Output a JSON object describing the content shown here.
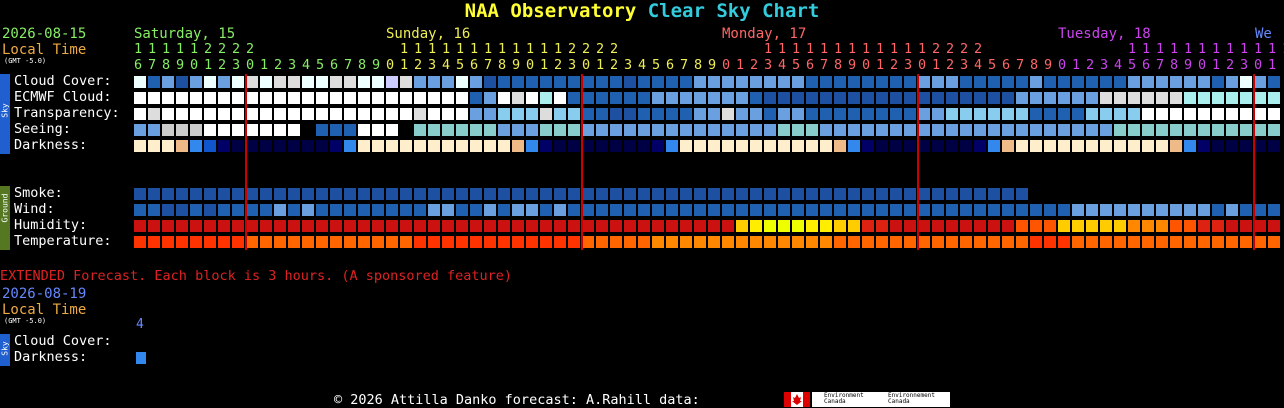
{
  "title": {
    "part1": "NAA Observatory",
    "part2": "Clear Sky Chart"
  },
  "header": {
    "date": "2026-08-15",
    "local_time": "Local Time",
    "gmt": "(GMT -5.0)"
  },
  "days": [
    {
      "label": "Saturday, 15",
      "color": "#88ee66"
    },
    {
      "label": "Sunday, 16",
      "color": "#eeee55"
    },
    {
      "label": "Monday, 17",
      "color": "#ff6666"
    },
    {
      "label": "Tuesday, 18",
      "color": "#cc44ee"
    },
    {
      "label": "We",
      "color": "#6688ff"
    }
  ],
  "hours": {
    "tens": [
      "1",
      "1",
      "1",
      "1",
      "1",
      "2",
      "2",
      "2",
      "2",
      "",
      "",
      "",
      "",
      "",
      "",
      "",
      "",
      "",
      "",
      "1",
      "1",
      "1",
      "1",
      "1",
      "1",
      "1",
      "1",
      "1",
      "1",
      "1",
      "1",
      "2",
      "2",
      "2",
      "2",
      "",
      "",
      "",
      "",
      "",
      "",
      "",
      "",
      "",
      "",
      "1",
      "1",
      "1",
      "1",
      "1",
      "1",
      "1",
      "1",
      "1",
      "1",
      "1",
      "1",
      "2",
      "2",
      "2",
      "2",
      "",
      "",
      "",
      "",
      "",
      "",
      "",
      "",
      "",
      "",
      "1",
      "1",
      "1",
      "1",
      "1",
      "1",
      "1",
      "1",
      "1",
      "1",
      "1",
      "1",
      "2",
      "2",
      "2",
      "2",
      "",
      ""
    ],
    "ones": [
      "6",
      "7",
      "8",
      "9",
      "0",
      "1",
      "2",
      "3",
      "0",
      "1",
      "2",
      "3",
      "4",
      "5",
      "6",
      "7",
      "8",
      "9",
      "0",
      "1",
      "2",
      "3",
      "4",
      "5",
      "6",
      "7",
      "8",
      "9",
      "0",
      "1",
      "2",
      "3",
      "0",
      "1",
      "2",
      "3",
      "4",
      "5",
      "6",
      "7",
      "8",
      "9",
      "0",
      "1",
      "2",
      "3",
      "4",
      "5",
      "6",
      "7",
      "8",
      "9",
      "0",
      "1",
      "2",
      "3",
      "0",
      "1",
      "2",
      "3",
      "4",
      "5",
      "6",
      "7",
      "8",
      "9",
      "0",
      "1",
      "2",
      "3",
      "4",
      "5",
      "6",
      "7",
      "8",
      "9",
      "0",
      "1",
      "2",
      "3",
      "0",
      "1"
    ]
  },
  "sky_side_label": "Sky",
  "ground_side_label": "Ground",
  "rows": [
    {
      "name": "cloud-cover",
      "label": "Cloud Cover:"
    },
    {
      "name": "ecmwf-cloud",
      "label": "ECMWF Cloud:"
    },
    {
      "name": "transparency",
      "label": "Transparency:"
    },
    {
      "name": "seeing",
      "label": "Seeing:"
    },
    {
      "name": "darkness",
      "label": "Darkness:"
    }
  ],
  "ground_rows": [
    {
      "name": "smoke",
      "label": "Smoke:"
    },
    {
      "name": "wind",
      "label": "Wind:"
    },
    {
      "name": "humidity",
      "label": "Humidity:"
    },
    {
      "name": "temperature",
      "label": "Temperature:"
    }
  ],
  "row_colors": {
    "cloud-cover": [
      "#eeffff",
      "#2060b0",
      "#6aa0e0",
      "#1d50a0",
      "#6aa0e0",
      "#eeffff",
      "#6aa0e0",
      "#eeffff",
      "#dddddd",
      "#eeffff",
      "#dddddd",
      "#dddddd",
      "#eeffff",
      "#eeffff",
      "#dddddd",
      "#dddddd",
      "#eeffff",
      "#eeffff",
      "#ccccff",
      "#dddddd",
      "#6aa0e0",
      "#6aa0e0",
      "#6aa0e0",
      "#eeffff",
      "#6aa0e0",
      "#1d50a0",
      "#2060b0",
      "#2060b0",
      "#2060b0",
      "#2060b0",
      "#2060b0",
      "#2060b0",
      "#2060b0",
      "#2060b0",
      "#2060b0",
      "#1d50a0",
      "#2060b0",
      "#2060b0",
      "#2060b0",
      "#2060b0",
      "#6aa0e0",
      "#6aa0e0",
      "#6aa0e0",
      "#6aa0e0",
      "#6aa0e0",
      "#6aa0e0",
      "#6aa0e0",
      "#6aa0e0",
      "#2060b0",
      "#2060b0",
      "#2060b0",
      "#2060b0",
      "#2060b0",
      "#2060b0",
      "#2060b0",
      "#2060b0",
      "#6aa0e0",
      "#6aa0e0",
      "#6aa0e0",
      "#2060b0",
      "#2060b0",
      "#2060b0",
      "#2060b0",
      "#2060b0",
      "#6aa0e0",
      "#2060b0",
      "#2060b0",
      "#2060b0",
      "#2060b0",
      "#2060b0",
      "#2060b0",
      "#6aa0e0",
      "#6aa0e0",
      "#6aa0e0",
      "#6aa0e0",
      "#6aa0e0",
      "#6aa0e0",
      "#2060b0",
      "#6aa0e0",
      "#eeffff",
      "#6aa0e0",
      "#2060b0"
    ],
    "ecmwf-cloud": [
      "#ffffff",
      "#ffffff",
      "#ffffff",
      "#ffffff",
      "#ffffff",
      "#ffffff",
      "#ffffff",
      "#ffffff",
      "#ffffff",
      "#ffffff",
      "#ffffff",
      "#ffffff",
      "#ffffff",
      "#ffffff",
      "#ffffff",
      "#ffffff",
      "#ffffff",
      "#ffffff",
      "#ffffff",
      "#ffffff",
      "#ffffff",
      "#ffffff",
      "#ffffff",
      "#ffffff",
      "#2060b0",
      "#6aa0e0",
      "#ffffff",
      "#dddddd",
      "#ffffff",
      "#aaeeee",
      "#ffffff",
      "#2060b0",
      "#2060b0",
      "#2060b0",
      "#2060b0",
      "#2060b0",
      "#2060b0",
      "#6aa0e0",
      "#6aa0e0",
      "#6aa0e0",
      "#6aa0e0",
      "#6aa0e0",
      "#6aa0e0",
      "#6aa0e0",
      "#2060b0",
      "#1d50a0",
      "#1d50a0",
      "#1d50a0",
      "#1d50a0",
      "#1d50a0",
      "#1d50a0",
      "#1d50a0",
      "#1d50a0",
      "#1d50a0",
      "#1d50a0",
      "#1d50a0",
      "#1d50a0",
      "#1d50a0",
      "#1d50a0",
      "#1d50a0",
      "#1d50a0",
      "#1d50a0",
      "#1d50a0",
      "#6aa0e0",
      "#6aa0e0",
      "#6aa0e0",
      "#6aa0e0",
      "#6aa0e0",
      "#6aa0e0",
      "#dddddd",
      "#dddddd",
      "#dddddd",
      "#dddddd",
      "#dddddd",
      "#dddddd",
      "#aaeeee",
      "#aaeeee",
      "#aaeeee",
      "#aaeeee",
      "#aaeeee",
      "#aaeeee",
      "#aaeeee"
    ],
    "transparency": [
      "#ffffff",
      "#dddddd",
      "#ffffff",
      "#ffffff",
      "#ffffff",
      "#ffffff",
      "#ffffff",
      "#ffffff",
      "#ffffff",
      "#ffffff",
      "#ffffff",
      "#ffffff",
      "#ffffff",
      "#ffffff",
      "#ffffff",
      "#ffffff",
      "#ffffff",
      "#ffffff",
      "#ffffff",
      "#ffffff",
      "#dddddd",
      "#ffffff",
      "#ffffff",
      "#ffffff",
      "#6aa0e0",
      "#6aa0e0",
      "#88ccee",
      "#88ccee",
      "#88ccee",
      "#dddddd",
      "#88ccee",
      "#88ccee",
      "#2060b0",
      "#2060b0",
      "#1d50a0",
      "#1d50a0",
      "#2060b0",
      "#2060b0",
      "#2060b0",
      "#2060b0",
      "#6aa0e0",
      "#6aa0e0",
      "#dddddd",
      "#6aa0e0",
      "#6aa0e0",
      "#2060b0",
      "#6aa0e0",
      "#6aa0e0",
      "#2060b0",
      "#2060b0",
      "#2060b0",
      "#2060b0",
      "#2060b0",
      "#2060b0",
      "#2060b0",
      "#2060b0",
      "#6aa0e0",
      "#6aa0e0",
      "#88ccee",
      "#88ccee",
      "#88ccee",
      "#88ccee",
      "#88ccee",
      "#88ccee",
      "#2060b0",
      "#2060b0",
      "#2060b0",
      "#2060b0",
      "#88ccee",
      "#88ccee",
      "#88ccee",
      "#88ccee",
      "#ffffff",
      "#ffffff",
      "#ffffff",
      "#ffffff",
      "#ffffff",
      "#ffffff",
      "#ffffff",
      "#ffffff",
      "#ffffff",
      "#ffffff"
    ],
    "seeing": [
      "#6aa0e0",
      "#6aa0e0",
      "#cccccc",
      "#cccccc",
      "#cccccc",
      "#ffffff",
      "#ffffff",
      "#ffffff",
      "#ffffff",
      "#ffffff",
      "#ffffff",
      "#ffffff",
      "#000000",
      "#2060b0",
      "#2060b0",
      "#2060b0",
      "#ffffff",
      "#ffffff",
      "#ffffff",
      "#000000",
      "#88cccc",
      "#88cccc",
      "#88cccc",
      "#88cccc",
      "#88cccc",
      "#88cccc",
      "#6aa0e0",
      "#6aa0e0",
      "#6aa0e0",
      "#88cccc",
      "#88cccc",
      "#88cccc",
      "#6aa0e0",
      "#6aa0e0",
      "#6aa0e0",
      "#6aa0e0",
      "#6aa0e0",
      "#6aa0e0",
      "#6aa0e0",
      "#6aa0e0",
      "#6aa0e0",
      "#6aa0e0",
      "#6aa0e0",
      "#6aa0e0",
      "#6aa0e0",
      "#6aa0e0",
      "#88cccc",
      "#88cccc",
      "#88cccc",
      "#6aa0e0",
      "#6aa0e0",
      "#6aa0e0",
      "#6aa0e0",
      "#6aa0e0",
      "#6aa0e0",
      "#6aa0e0",
      "#6aa0e0",
      "#6aa0e0",
      "#6aa0e0",
      "#6aa0e0",
      "#6aa0e0",
      "#6aa0e0",
      "#6aa0e0",
      "#6aa0e0",
      "#6aa0e0",
      "#6aa0e0",
      "#6aa0e0",
      "#6aa0e0",
      "#6aa0e0",
      "#6aa0e0",
      "#88cccc",
      "#88cccc",
      "#88cccc",
      "#88cccc",
      "#88cccc",
      "#88cccc",
      "#88cccc",
      "#88cccc",
      "#88cccc",
      "#88cccc",
      "#88cccc",
      "#88cccc"
    ],
    "darkness": [
      "#ffeecc",
      "#ffeecc",
      "#ffeecc",
      "#eebb88",
      "#3388ee",
      "#1155cc",
      "#000066",
      "#000044",
      "#000044",
      "#000044",
      "#000044",
      "#000044",
      "#000044",
      "#000044",
      "#000066",
      "#3388ee",
      "#ffeecc",
      "#ffeecc",
      "#ffeecc",
      "#ffeecc",
      "#ffeecc",
      "#ffeecc",
      "#ffeecc",
      "#ffeecc",
      "#ffeecc",
      "#ffeecc",
      "#ffeecc",
      "#eebb88",
      "#3388ee",
      "#000066",
      "#000044",
      "#000044",
      "#000044",
      "#000044",
      "#000044",
      "#000044",
      "#000044",
      "#000066",
      "#3388ee",
      "#ffeecc",
      "#ffeecc",
      "#ffeecc",
      "#ffeecc",
      "#ffeecc",
      "#ffeecc",
      "#ffeecc",
      "#ffeecc",
      "#ffeecc",
      "#ffeecc",
      "#ffeecc",
      "#eebb88",
      "#3388ee",
      "#000066",
      "#000044",
      "#000044",
      "#000044",
      "#000044",
      "#000044",
      "#000044",
      "#000044",
      "#000066",
      "#3388ee",
      "#eebb88",
      "#ffeecc",
      "#ffeecc",
      "#ffeecc",
      "#ffeecc",
      "#ffeecc",
      "#ffeecc",
      "#ffeecc",
      "#ffeecc",
      "#ffeecc",
      "#ffeecc",
      "#ffeecc",
      "#eebb88",
      "#3388ee",
      "#000066",
      "#000044",
      "#000044",
      "#000044",
      "#000044",
      "#000044"
    ],
    "smoke": [
      "#1d50a0",
      "#1d50a0",
      "#1d50a0",
      "#1d50a0",
      "#1d50a0",
      "#1d50a0",
      "#1d50a0",
      "#1d50a0",
      "#1d50a0",
      "#1d50a0",
      "#1d50a0",
      "#1d50a0",
      "#1d50a0",
      "#1d50a0",
      "#1d50a0",
      "#1d50a0",
      "#1d50a0",
      "#1d50a0",
      "#1d50a0",
      "#1d50a0",
      "#1d50a0",
      "#1d50a0",
      "#1d50a0",
      "#1d50a0",
      "#1d50a0",
      "#1d50a0",
      "#1d50a0",
      "#1d50a0",
      "#1d50a0",
      "#1d50a0",
      "#1d50a0",
      "#1d50a0",
      "#1d50a0",
      "#1d50a0",
      "#1d50a0",
      "#1d50a0",
      "#1d50a0",
      "#1d50a0",
      "#1d50a0",
      "#1d50a0",
      "#1d50a0",
      "#1d50a0",
      "#1d50a0",
      "#1d50a0",
      "#1d50a0",
      "#1d50a0",
      "#1d50a0",
      "#1d50a0",
      "#1d50a0",
      "#1d50a0",
      "#1d50a0",
      "#1d50a0",
      "#1d50a0",
      "#1d50a0",
      "#1d50a0",
      "#1d50a0",
      "#1d50a0",
      "#1d50a0",
      "#1d50a0",
      "#1d50a0",
      "#1d50a0",
      "#1d50a0",
      "#1d50a0",
      "#1d50a0"
    ],
    "wind": [
      "#2060b0",
      "#2060b0",
      "#1d50a0",
      "#1d50a0",
      "#2060b0",
      "#1d50a0",
      "#2060b0",
      "#2060b0",
      "#2060b0",
      "#2060b0",
      "#6aa0e0",
      "#2060b0",
      "#6aa0e0",
      "#2060b0",
      "#2060b0",
      "#2060b0",
      "#2060b0",
      "#2060b0",
      "#2060b0",
      "#2060b0",
      "#2060b0",
      "#6aa0e0",
      "#6aa0e0",
      "#2060b0",
      "#2060b0",
      "#6aa0e0",
      "#2060b0",
      "#6aa0e0",
      "#6aa0e0",
      "#2060b0",
      "#6aa0e0",
      "#2060b0",
      "#2060b0",
      "#2060b0",
      "#2060b0",
      "#2060b0",
      "#2060b0",
      "#2060b0",
      "#2060b0",
      "#2060b0",
      "#2060b0",
      "#2060b0",
      "#2060b0",
      "#2060b0",
      "#2060b0",
      "#2060b0",
      "#2060b0",
      "#2060b0",
      "#2060b0",
      "#2060b0",
      "#2060b0",
      "#2060b0",
      "#2060b0",
      "#2060b0",
      "#2060b0",
      "#2060b0",
      "#2060b0",
      "#2060b0",
      "#2060b0",
      "#2060b0",
      "#2060b0",
      "#2060b0",
      "#2060b0",
      "#2060b0",
      "#2060b0",
      "#2060b0",
      "#2060b0",
      "#6aa0e0",
      "#6aa0e0",
      "#6aa0e0",
      "#6aa0e0",
      "#6aa0e0",
      "#6aa0e0",
      "#6aa0e0",
      "#6aa0e0",
      "#6aa0e0",
      "#6aa0e0",
      "#2060b0",
      "#6aa0e0",
      "#2060b0",
      "#2060b0",
      "#2060b0"
    ],
    "humidity": [
      "#cc1111",
      "#cc1111",
      "#cc1111",
      "#cc1111",
      "#cc1111",
      "#cc1111",
      "#cc1111",
      "#cc1111",
      "#cc1111",
      "#cc1111",
      "#cc1111",
      "#cc1111",
      "#cc1111",
      "#cc1111",
      "#cc1111",
      "#cc1111",
      "#cc1111",
      "#cc1111",
      "#cc1111",
      "#cc1111",
      "#cc1111",
      "#cc1111",
      "#cc1111",
      "#cc1111",
      "#cc1111",
      "#cc1111",
      "#cc1111",
      "#cc1111",
      "#cc1111",
      "#cc1111",
      "#cc1111",
      "#cc1111",
      "#cc1111",
      "#cc1111",
      "#cc1111",
      "#cc1111",
      "#cc1111",
      "#cc1111",
      "#cc1111",
      "#cc1111",
      "#cc1111",
      "#cc1111",
      "#cc1111",
      "#ffcc00",
      "#ffee00",
      "#eeff00",
      "#eeff00",
      "#eeff00",
      "#ffee00",
      "#ffee00",
      "#ffcc00",
      "#ffcc00",
      "#dd2211",
      "#dd2211",
      "#cc1111",
      "#cc1111",
      "#cc1111",
      "#cc1111",
      "#cc1111",
      "#cc1111",
      "#cc1111",
      "#cc1111",
      "#cc1111",
      "#ff5500",
      "#ff5500",
      "#ff5500",
      "#ffcc00",
      "#ffcc00",
      "#ffcc00",
      "#ffcc00",
      "#ffcc00",
      "#ff8800",
      "#ff8800",
      "#ff8800",
      "#ff5500",
      "#ff5500",
      "#dd2211",
      "#dd2211",
      "#cc1111",
      "#cc1111",
      "#cc1111",
      "#cc1111"
    ],
    "temperature": [
      "#ff3300",
      "#ff3300",
      "#ff3300",
      "#ff3300",
      "#ff3300",
      "#ff3300",
      "#ff3300",
      "#ff3300",
      "#ff6600",
      "#ff6600",
      "#ff6600",
      "#ff6600",
      "#ff6600",
      "#ff6600",
      "#ff6600",
      "#ff6600",
      "#ff6600",
      "#ff6600",
      "#ff6600",
      "#ff6600",
      "#ff3300",
      "#ff3300",
      "#ff3300",
      "#ff3300",
      "#ff3300",
      "#ff3300",
      "#ff3300",
      "#ff3300",
      "#ff3300",
      "#ff3300",
      "#ff3300",
      "#ff3300",
      "#ff6600",
      "#ff6600",
      "#ff6600",
      "#ff6600",
      "#ff6600",
      "#ff8800",
      "#ff8800",
      "#ff8800",
      "#ff8800",
      "#ff8800",
      "#ff8800",
      "#ff8800",
      "#ff8800",
      "#ff8800",
      "#ff8800",
      "#ff8800",
      "#ff8800",
      "#ff8800",
      "#ff6600",
      "#ff6600",
      "#ff6600",
      "#ff6600",
      "#ff6600",
      "#ff6600",
      "#ff6600",
      "#ff6600",
      "#ff6600",
      "#ff6600",
      "#ff6600",
      "#ff6600",
      "#ff6600",
      "#ff6600",
      "#ff3300",
      "#ff3300",
      "#ff3300",
      "#ff6600",
      "#ff6600",
      "#ff6600",
      "#ff6600",
      "#ff6600",
      "#ff6600",
      "#ff6600",
      "#ff6600",
      "#ff6600",
      "#ff6600",
      "#ff6600",
      "#ff6600",
      "#ff6600",
      "#ff6600",
      "#ff6600"
    ]
  },
  "extended": {
    "note": "EXTENDED Forecast. Each block is 3 hours. (A sponsored feature)",
    "date": "2026-08-19",
    "local_time": "Local Time",
    "gmt": "(GMT -5.0)",
    "hour": "4",
    "cloud_label": "Cloud Cover:",
    "darkness_label": "Darkness:",
    "darkness_colors": [
      "#3388ee"
    ]
  },
  "footer": {
    "text": "© 2026 Attilla Danko  forecast: A.Rahill  data:",
    "logo_en": "Environment Canada",
    "logo_fr": "Environnement Canada"
  }
}
